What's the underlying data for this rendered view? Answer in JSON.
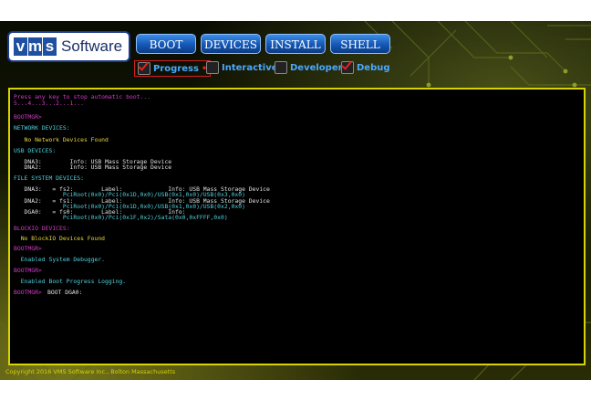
{
  "logo": {
    "letters": [
      "v",
      "m",
      "s"
    ],
    "word": "Software"
  },
  "toolbar": {
    "boot": "BOOT",
    "devices": "DEVICES",
    "install": "INSTALL",
    "shell": "SHELL"
  },
  "options": [
    {
      "label": "Progress",
      "checked": true,
      "marker": "•"
    },
    {
      "label": "Interactive",
      "checked": false
    },
    {
      "label": "Developer",
      "checked": false
    },
    {
      "label": "Debug",
      "checked": true
    }
  ],
  "console": {
    "lines": [
      {
        "text": "Press any key to stop automatic boot...",
        "color": "magenta"
      },
      {
        "text": "5...4...3...2...1...",
        "color": "magenta"
      },
      {
        "text": "BOOTMGR>",
        "color": "magenta"
      },
      {
        "text": "NETWORK DEVICES:",
        "color": "cyan"
      },
      {
        "text": "   No Network Devices Found",
        "color": "yellow"
      },
      {
        "text": "USB DEVICES:",
        "color": "cyan"
      },
      {
        "text": "   DNA3:        Info: USB Mass Storage Device",
        "color": "white"
      },
      {
        "text": "   DNA2:        Info: USB Mass Storage Device",
        "color": "white"
      },
      {
        "text": "FILE SYSTEM DEVICES:",
        "color": "cyan"
      },
      {
        "text": "   DNA3:   = fs2:        Label:             Info: USB Mass Storage Device",
        "color": "white"
      },
      {
        "text": "              PciRoot(0x0)/Pci(0x1D,0x0)/USB(0x1,0x0)/USB(0x3,0x0)",
        "color": "cyan"
      },
      {
        "text": "   DNA2:   = fs1:        Label:             Info: USB Mass Storage Device",
        "color": "white"
      },
      {
        "text": "              PciRoot(0x0)/Pci(0x1D,0x0)/USB(0x1,0x0)/USB(0x2,0x0)",
        "color": "cyan"
      },
      {
        "text": "   DGA0:   = fs0:        Label:             Info:",
        "color": "white"
      },
      {
        "text": "              PciRoot(0x0)/Pci(0x1F,0x2)/Sata(0x0,0xFFFF,0x0)",
        "color": "cyan"
      },
      {
        "text": "BLOCKIO DEVICES:",
        "color": "magenta"
      },
      {
        "text": "  No BlockIO Devices Found",
        "color": "yellow"
      },
      {
        "text": "BOOTMGR>",
        "color": "magenta"
      },
      {
        "text": "  Enabled System Debugger.",
        "color": "cyan"
      },
      {
        "text": "BOOTMGR>",
        "color": "magenta"
      },
      {
        "text": "  Enabled Boot Progress Logging.",
        "color": "cyan"
      },
      {
        "text": "BOOTMGR>",
        "color": "magenta"
      },
      {
        "text": "BOOT DGA0:",
        "color": "white"
      }
    ]
  },
  "copyright": "Copyright 2016 VMS Software Inc., Bolton Massachusetts"
}
